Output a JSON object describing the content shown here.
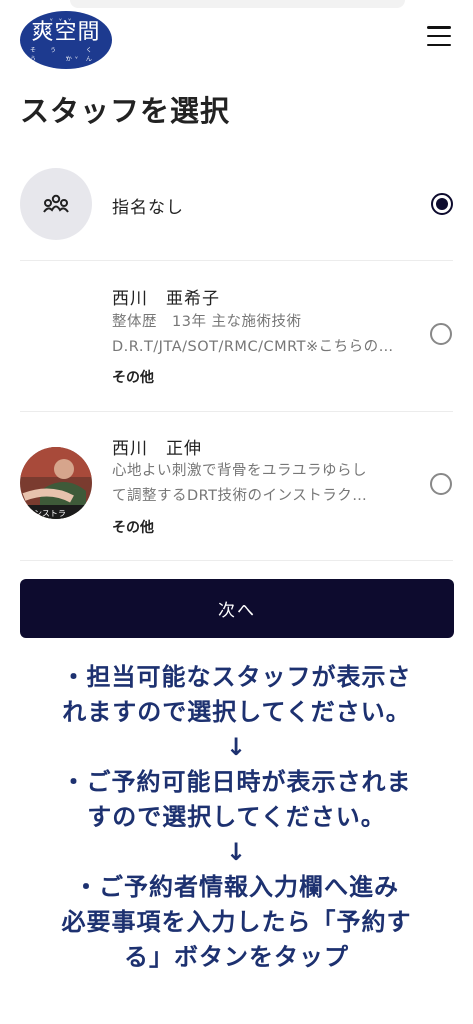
{
  "header": {
    "logo": {
      "text": "爽空間",
      "ruby": "そう くう かん"
    },
    "menu_icon": "hamburger-menu-icon"
  },
  "page": {
    "title": "スタッフを選択"
  },
  "staff": [
    {
      "name": "指名なし",
      "icon": "group-icon",
      "selected": true
    },
    {
      "name": "西川　亜希子",
      "desc_lines": [
        "整体歴　13年 主な施術技術",
        "D.R.T/JTA/SOT/RMC/CMRT※こちらの…"
      ],
      "more": "その他",
      "selected": false
    },
    {
      "name": "西川　正伸",
      "desc_lines": [
        "心地よい刺激で背骨をユラユラゆらし",
        "て調整するDRT技術のインストラク…"
      ],
      "more": "その他",
      "selected": false
    }
  ],
  "actions": {
    "next_label": "次へ"
  },
  "guide": {
    "lines": [
      "・担当可能なスタッフが表示さ",
      "れますので選択してください。",
      "↓",
      "・ご予約可能日時が表示されま",
      "すので選択してください。",
      "↓",
      "・ご予約者情報入力欄へ進み",
      "必要事項を入力したら「予約す",
      "る」ボタンをタップ"
    ]
  },
  "colors": {
    "accent": "#0d0b2e",
    "logo_bg": "#1d3a8f",
    "guide_text": "#1d3170"
  }
}
